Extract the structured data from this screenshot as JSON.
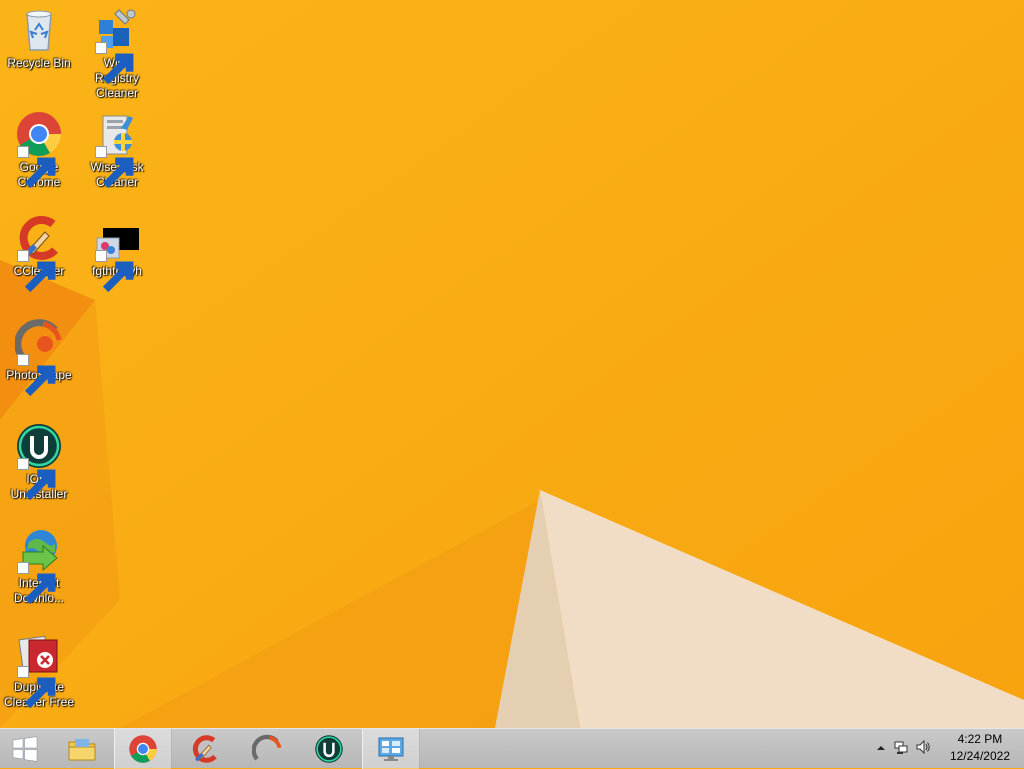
{
  "desktop": {
    "icons": [
      {
        "label": "Recycle Bin",
        "icon": "recycle-bin-icon"
      },
      {
        "label": "Wise Registry\nCleaner",
        "icon": "wise-registry-cleaner-icon"
      },
      {
        "label": "Google\nChrome",
        "icon": "chrome-icon"
      },
      {
        "label": "Wise Disk\nCleaner",
        "icon": "wise-disk-cleaner-icon"
      },
      {
        "label": "CCleaner",
        "icon": "ccleaner-icon"
      },
      {
        "label": "fgthtrfftyh",
        "icon": "file-icon"
      },
      {
        "label": "PhotoScape",
        "icon": "photoscape-icon"
      },
      {
        "label": "IObit\nUninstaller",
        "icon": "iobit-uninstaller-icon"
      },
      {
        "label": "Internet\nDownlo...",
        "icon": "internet-download-manager-icon"
      },
      {
        "label": "Duplicate\nCleaner Free",
        "icon": "duplicate-cleaner-icon"
      }
    ]
  },
  "taskbar": {
    "start": "windows-logo-icon",
    "pinned": [
      {
        "name": "file-explorer",
        "icon": "folder-icon"
      },
      {
        "name": "chrome",
        "icon": "chrome-icon"
      },
      {
        "name": "ccleaner",
        "icon": "ccleaner-icon"
      },
      {
        "name": "photoscape",
        "icon": "photoscape-icon"
      },
      {
        "name": "iobit-uninstaller",
        "icon": "iobit-uninstaller-icon"
      },
      {
        "name": "control-panel",
        "icon": "control-panel-icon"
      }
    ],
    "clock": {
      "time": "4:22 PM",
      "date": "12/24/2022"
    }
  },
  "colors": {
    "wallpaper": "#f7a913",
    "taskbar": "#c2c2c2"
  }
}
